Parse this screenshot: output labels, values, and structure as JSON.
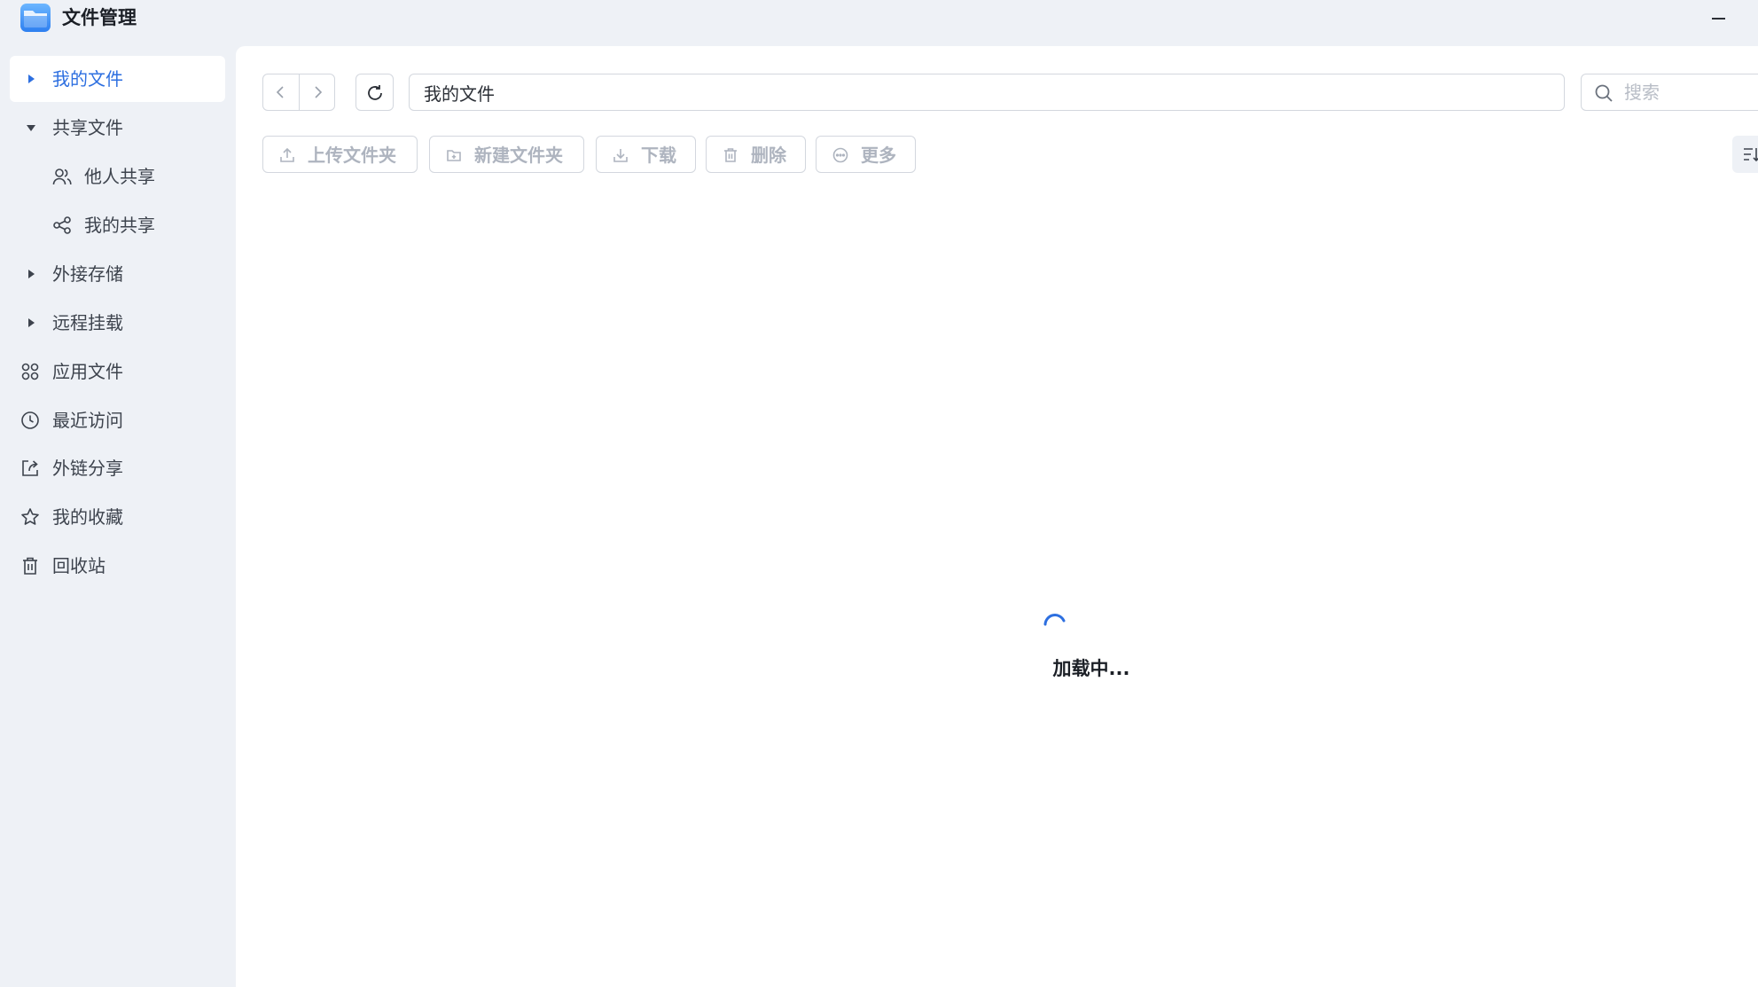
{
  "window": {
    "title": "文件管理",
    "app_icon": "folder-icon",
    "minimize_icon": "minimize-icon"
  },
  "sidebar": {
    "items": [
      {
        "label": "我的文件",
        "icon": "caret-right-icon",
        "active": true
      },
      {
        "label": "共享文件",
        "icon": "caret-down-icon",
        "expanded": true
      },
      {
        "label": "他人共享",
        "icon": "users-icon"
      },
      {
        "label": "我的共享",
        "icon": "share-nodes-icon"
      },
      {
        "label": "外接存储",
        "icon": "caret-right-icon"
      },
      {
        "label": "远程挂载",
        "icon": "caret-right-icon"
      },
      {
        "label": "应用文件",
        "icon": "apps-grid-icon"
      },
      {
        "label": "最近访问",
        "icon": "clock-icon"
      },
      {
        "label": "外链分享",
        "icon": "external-share-icon"
      },
      {
        "label": "我的收藏",
        "icon": "star-icon"
      },
      {
        "label": "回收站",
        "icon": "trash-icon"
      }
    ]
  },
  "navigation": {
    "path_value": "我的文件",
    "search_placeholder": "搜索"
  },
  "toolbar": {
    "upload_folder": "上传文件夹",
    "new_folder": "新建文件夹",
    "download": "下载",
    "delete": "删除",
    "more": "更多"
  },
  "status": {
    "loading_text": "加载中..."
  },
  "colors": {
    "accent": "#2d6fe0",
    "sidebar_bg": "#eef1f6",
    "disabled_text": "#aeb4bf"
  }
}
